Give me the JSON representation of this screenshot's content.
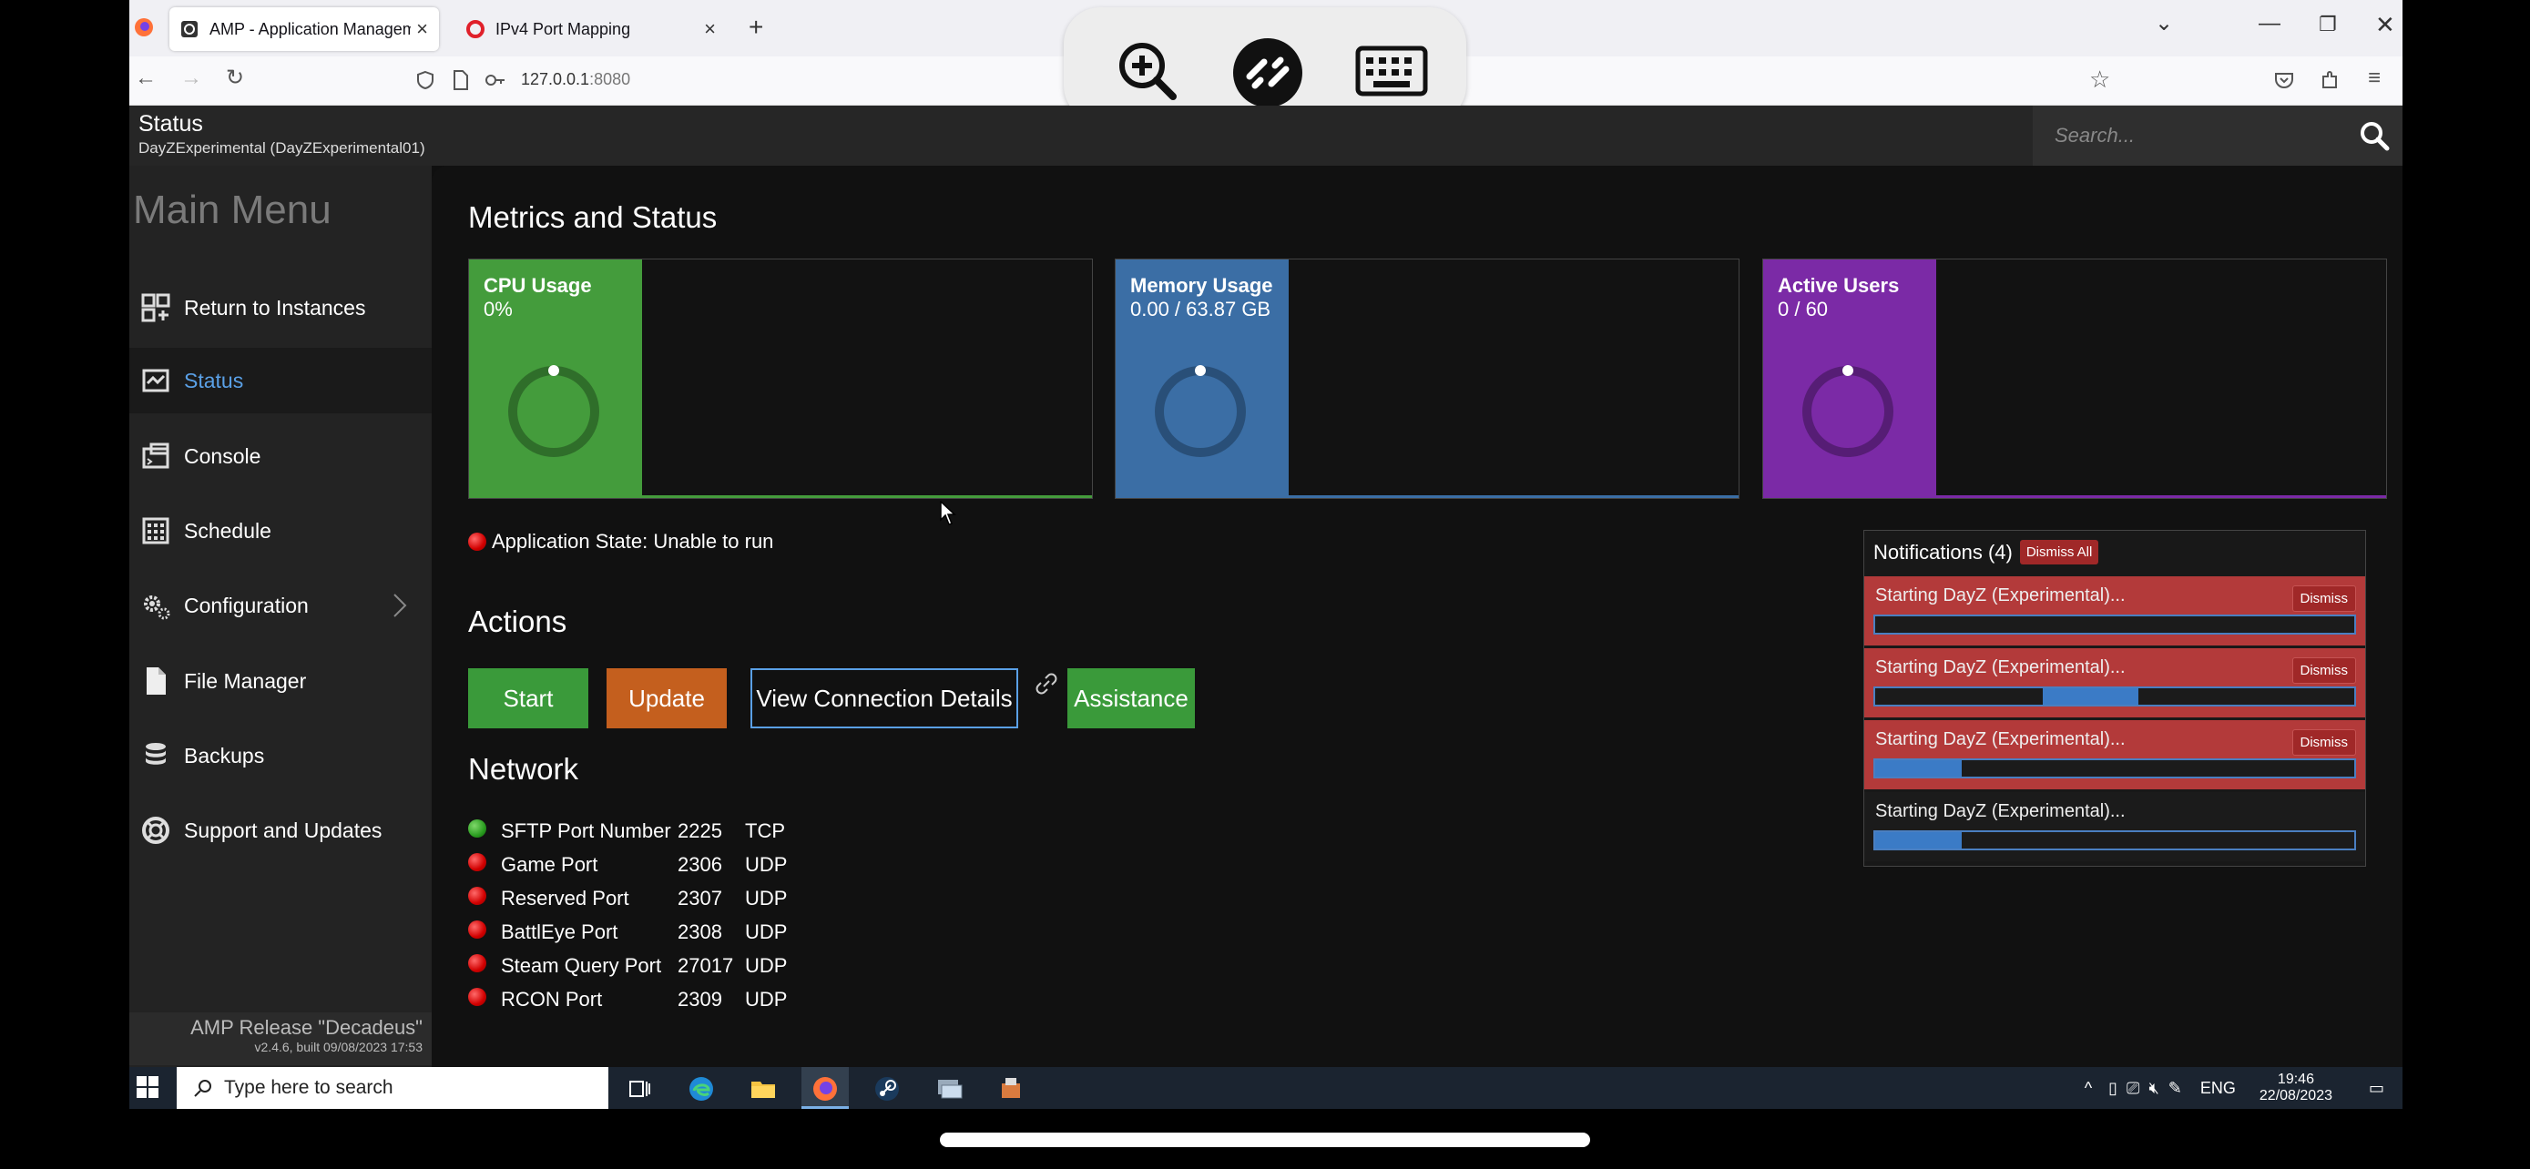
{
  "browser": {
    "tabs": [
      {
        "title": "AMP - Application Managem",
        "active": true
      },
      {
        "title": "IPv4 Port Mapping",
        "active": false
      }
    ],
    "url_host": "127.0.0.1",
    "url_port": ":8080"
  },
  "header": {
    "title": "Status",
    "subtitle": "DayZExperimental (DayZExperimental01)",
    "search_placeholder": "Search..."
  },
  "sidebar": {
    "title": "Main Menu",
    "items": [
      {
        "label": "Return to Instances",
        "icon": "instances-icon"
      },
      {
        "label": "Status",
        "icon": "status-icon",
        "active": true
      },
      {
        "label": "Console",
        "icon": "console-icon"
      },
      {
        "label": "Schedule",
        "icon": "schedule-icon"
      },
      {
        "label": "Configuration",
        "icon": "gear-icon",
        "has_submenu": true
      },
      {
        "label": "File Manager",
        "icon": "file-icon"
      },
      {
        "label": "Backups",
        "icon": "database-icon"
      },
      {
        "label": "Support and Updates",
        "icon": "lifebuoy-icon"
      }
    ],
    "footer_release": "AMP Release \"Decadeus\"",
    "footer_build": "v2.4.6, built 09/08/2023 17:53"
  },
  "main": {
    "metrics_title": "Metrics and Status",
    "metrics": [
      {
        "label": "CPU Usage",
        "value": "0%",
        "color": "#449c3c"
      },
      {
        "label": "Memory Usage",
        "value": "0.00 / 63.87 GB",
        "color": "#3b6ea5"
      },
      {
        "label": "Active Users",
        "value": "0 / 60",
        "color": "#7b2aa6"
      }
    ],
    "app_state": "Application State: Unable to run",
    "actions_title": "Actions",
    "actions": {
      "start": "Start",
      "update": "Update",
      "view_connection": "View Connection Details",
      "assistance": "Assistance"
    },
    "network_title": "Network",
    "network": [
      {
        "name": "SFTP Port Number",
        "port": "2225",
        "protocol": "TCP",
        "status": "green"
      },
      {
        "name": "Game Port",
        "port": "2306",
        "protocol": "UDP",
        "status": "red"
      },
      {
        "name": "Reserved Port",
        "port": "2307",
        "protocol": "UDP",
        "status": "red"
      },
      {
        "name": "BattlEye Port",
        "port": "2308",
        "protocol": "UDP",
        "status": "red"
      },
      {
        "name": "Steam Query Port",
        "port": "27017",
        "protocol": "UDP",
        "status": "red"
      },
      {
        "name": "RCON Port",
        "port": "2309",
        "protocol": "UDP",
        "status": "red"
      }
    ]
  },
  "notifications": {
    "title": "Notifications (4)",
    "dismiss_all": "Dismiss All",
    "items": [
      {
        "text": "Starting DayZ (Experimental)...",
        "dismiss": "Dismiss",
        "error": true,
        "progress_start": 0,
        "progress_end": 0
      },
      {
        "text": "Starting DayZ (Experimental)...",
        "dismiss": "Dismiss",
        "error": true,
        "progress_start": 0.35,
        "progress_end": 0.55
      },
      {
        "text": "Starting DayZ (Experimental)...",
        "dismiss": "Dismiss",
        "error": true,
        "progress_start": 0,
        "progress_end": 0.18
      },
      {
        "text": "Starting DayZ (Experimental)...",
        "dismiss": "",
        "error": false,
        "progress_start": 0,
        "progress_end": 0.18
      }
    ]
  },
  "taskbar": {
    "search_placeholder": "Type here to search",
    "language": "ENG",
    "time": "19:46",
    "date": "22/08/2023"
  }
}
